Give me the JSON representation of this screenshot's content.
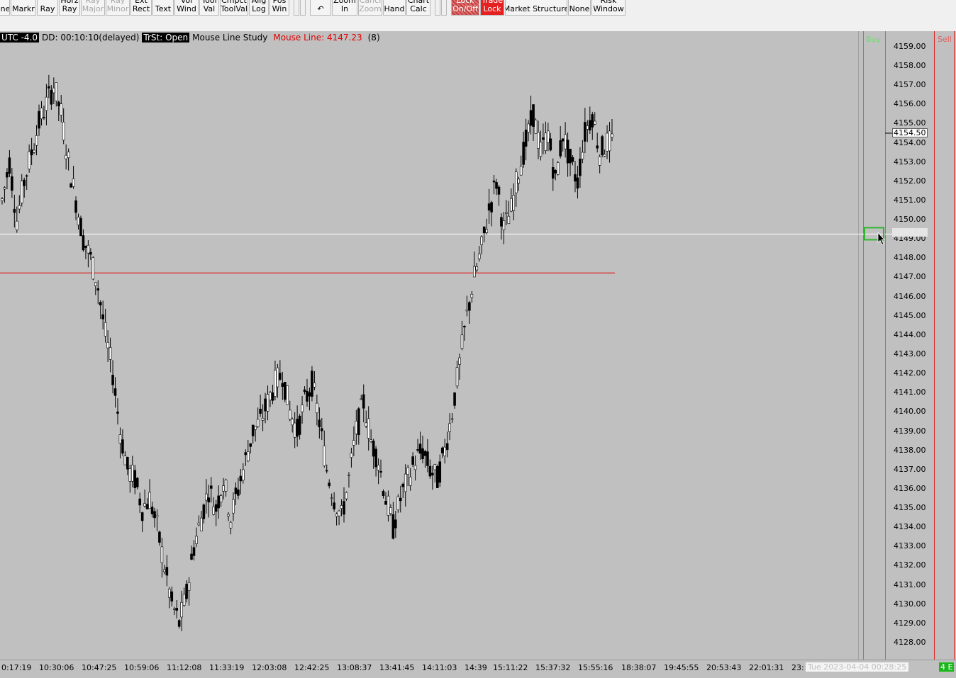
{
  "toolbar": {
    "buttons": [
      {
        "label": "ine",
        "state": "normal"
      },
      {
        "label": "Markr",
        "state": "normal"
      },
      {
        "label": "Ray",
        "state": "normal"
      },
      {
        "label": "Horz\nRay",
        "state": "normal"
      },
      {
        "label": "Ray\nMajor",
        "state": "disabled"
      },
      {
        "label": "Ray\nMinor",
        "state": "disabled"
      },
      {
        "label": "Ext\nRect",
        "state": "normal"
      },
      {
        "label": "Text",
        "state": "normal"
      },
      {
        "label": "Vol\nWind",
        "state": "normal"
      },
      {
        "label": "Tool\nVal",
        "state": "normal"
      },
      {
        "label": "Cmpct\nToolVal",
        "state": "normal"
      },
      {
        "label": "Alig\nLog",
        "state": "normal"
      },
      {
        "label": "Pos\nWin",
        "state": "normal"
      },
      {
        "label": "",
        "state": "blank"
      },
      {
        "label": "",
        "state": "blank"
      },
      {
        "label": "↶",
        "state": "normal"
      },
      {
        "label": "Zoom\nIn",
        "state": "normal"
      },
      {
        "label": "Cancl\nZoom",
        "state": "disabled"
      },
      {
        "label": "Hand",
        "state": "normal"
      },
      {
        "label": "Chart\nCalc",
        "state": "normal"
      },
      {
        "label": "",
        "state": "blank"
      },
      {
        "label": "",
        "state": "blank"
      },
      {
        "label": "Lock\nOn/Off",
        "state": "hatch"
      },
      {
        "label": "Trade\nLock",
        "state": "red"
      },
      {
        "label": "Market Structure",
        "state": "normal"
      },
      {
        "label": "None",
        "state": "normal"
      },
      {
        "label": "Risk\nWindow",
        "state": "normal"
      }
    ]
  },
  "status": {
    "timezone": "UTC -4.0",
    "dd": "DD: 00:10:10(delayed)",
    "trade_state": "TrSt: Open",
    "study": "Mouse Line Study",
    "mouse_line": "Mouse Line: 4147.23",
    "count": "(8)"
  },
  "ladder": {
    "buy_label": "Buy",
    "sell_label": "Sell"
  },
  "price_box": "4154.50",
  "hover_price": "4149.25",
  "yaxis_labels": [
    "4159.00",
    "4158.00",
    "4157.00",
    "4156.00",
    "4155.00",
    "4154.00",
    "4153.00",
    "4152.00",
    "4151.00",
    "4150.00",
    "4149.00",
    "4148.00",
    "4147.00",
    "4146.00",
    "4145.00",
    "4144.00",
    "4143.00",
    "4142.00",
    "4141.00",
    "4140.00",
    "4139.00",
    "4138.00",
    "4137.00",
    "4136.00",
    "4135.00",
    "4134.00",
    "4133.00",
    "4132.00",
    "4131.00",
    "4130.00",
    "4129.00",
    "4128.00"
  ],
  "xaxis_labels": [
    "0:17:19",
    "10:30:06",
    "10:47:25",
    "10:59:06",
    "11:12:08",
    "11:33:19",
    "12:03:08",
    "12:42:25",
    "13:08:37",
    "13:41:45",
    "14:11:03",
    "14:39",
    "15:11:22",
    "15:37:32",
    "15:55:16",
    "18:38:07",
    "19:45:55",
    "20:53:43",
    "22:01:31",
    "23:"
  ],
  "date_box": "Tue 2023-04-04  00:28:25",
  "corner_badge": "4 E",
  "colors": {
    "chart_bg": "#c0c0c0",
    "mouse_line": "#e00000",
    "crosshair": "#ffffff",
    "buy": "#2eb82e",
    "sell": "#e02020"
  },
  "chart_data": {
    "type": "candlestick",
    "ylim": [
      4127.5,
      4159.5
    ],
    "mouse_line_price": 4147.23,
    "crosshair_price": 4149.25,
    "price_tag": 4154.5,
    "close_path": [
      4151,
      4153,
      4150,
      4152,
      4153.5,
      4155,
      4156,
      4157,
      4155.5,
      4153,
      4151,
      4149,
      4148,
      4146.5,
      4144,
      4142,
      4139,
      4137,
      4136.5,
      4135,
      4135.5,
      4134,
      4132,
      4130,
      4129,
      4130.5,
      4133,
      4134.5,
      4136,
      4135,
      4136.5,
      4134.5,
      4136,
      4137.5,
      4139,
      4139.5,
      4140.5,
      4141.5,
      4142,
      4140,
      4139,
      4140.5,
      4141.5,
      4139.5,
      4137,
      4135.5,
      4134.5,
      4136.5,
      4139,
      4140.5,
      4138.5,
      4137.5,
      4135.5,
      4134,
      4135.5,
      4136.5,
      4137.5,
      4138,
      4137,
      4136.5,
      4138,
      4140,
      4142.5,
      4145,
      4147,
      4148.5,
      4150.5,
      4152,
      4149.5,
      4150.5,
      4152.5,
      4154,
      4155.5,
      4153.5,
      4154.5,
      4152,
      4154.5,
      4153,
      4152,
      4154.5,
      4155.5,
      4153.5,
      4154
    ]
  }
}
